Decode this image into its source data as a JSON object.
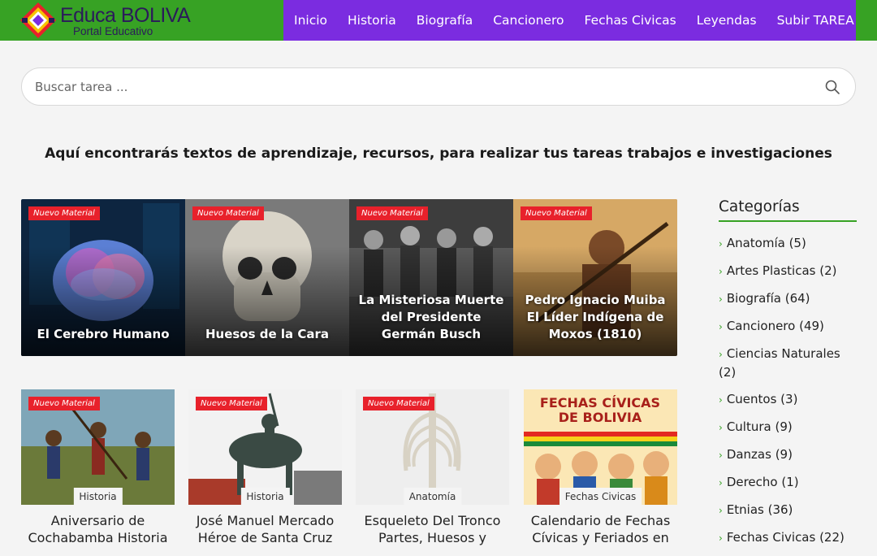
{
  "brand": {
    "title": "Educa BOLIVA",
    "subtitle": "Portal Educativo"
  },
  "nav": [
    "Inicio",
    "Historia",
    "Biografía",
    "Cancionero",
    "Fechas Civicas",
    "Leyendas",
    "Subir TAREA"
  ],
  "search": {
    "placeholder": "Buscar tarea ...",
    "value": ""
  },
  "tagline": "Aquí encontrarás textos de aprendizaje, recursos, para realizar tus tareas trabajos e investigaciones",
  "featured": [
    {
      "badge": "Nuevo Material",
      "title": "El Cerebro Humano"
    },
    {
      "badge": "Nuevo Material",
      "title": "Huesos de la Cara"
    },
    {
      "badge": "Nuevo Material",
      "title": "La Misteriosa Muerte del Presidente Germán Busch"
    },
    {
      "badge": "Nuevo Material",
      "title": "Pedro Ignacio Muiba El Líder Indígena de Moxos (1810)"
    }
  ],
  "cards": [
    {
      "badge": "Nuevo Material",
      "category": "Historia",
      "title": "Aniversario de Cochabamba Historia"
    },
    {
      "badge": "Nuevo Material",
      "category": "Historia",
      "title": "José Manuel Mercado Héroe de Santa Cruz"
    },
    {
      "badge": "Nuevo Material",
      "category": "Anatomía",
      "title": "Esqueleto Del Tronco Partes, Huesos y"
    },
    {
      "badge": "",
      "category": "Fechas Civicas",
      "title": "Calendario de Fechas Cívicas y Feriados en",
      "poster_line1": "FECHAS CÍVICAS",
      "poster_line2": "DE BOLIVIA"
    }
  ],
  "sidebar": {
    "title": "Categorías",
    "items": [
      "Anatomía (5)",
      "Artes Plasticas (2)",
      "Biografía (64)",
      "Cancionero (49)",
      "Ciencias Naturales (2)",
      "Cuentos (3)",
      "Cultura (9)",
      "Danzas (9)",
      "Derecho (1)",
      "Etnias (36)",
      "Fechas Civicas (22)"
    ]
  },
  "colors": {
    "header_green": "#37a224",
    "nav_purple": "#7b2ce0",
    "badge_red": "#e8212b"
  }
}
